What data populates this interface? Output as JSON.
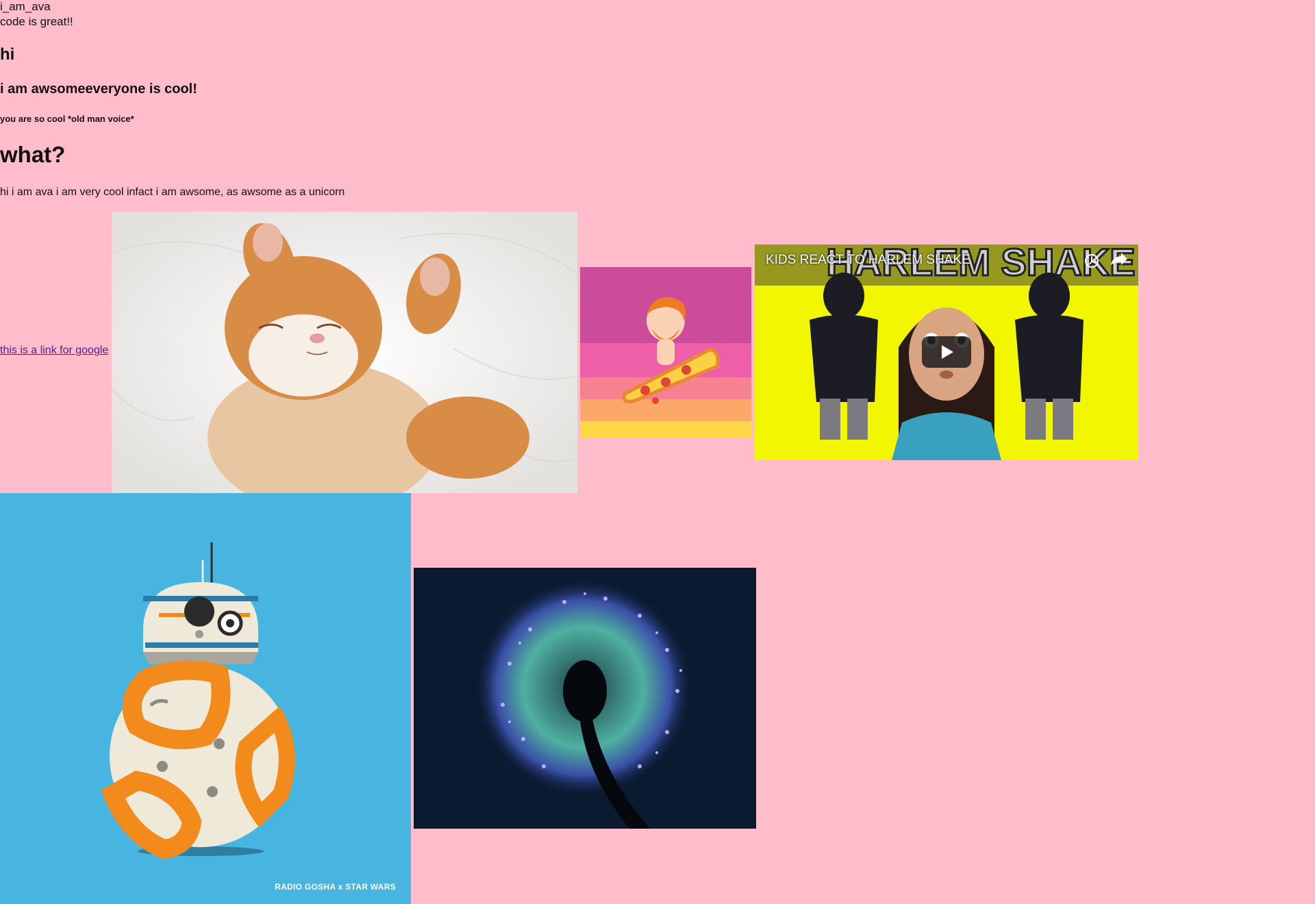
{
  "header": {
    "username": "i_am_ava",
    "tagline": "code is great!!"
  },
  "headings": {
    "hi": "hi",
    "awesome": "i am awsomeeveryone is cool!",
    "old_man": "you are so cool *old man voice*",
    "what": "what?"
  },
  "paragraph": "hi i am ava i am very cool infact i am awsome, as awsome as a unicorn",
  "link": {
    "text": "this is a link for google"
  },
  "video": {
    "title": "KIDS REACT TO HARLEM SHAKE",
    "thumbnail_text": "HARLEM SHAKE"
  },
  "bb8": {
    "credit": "RADIO GOSHA x STAR WARS"
  },
  "colors": {
    "background": "#ffbccb",
    "link": "#551a8b",
    "bb8_background": "#47b5e0"
  }
}
